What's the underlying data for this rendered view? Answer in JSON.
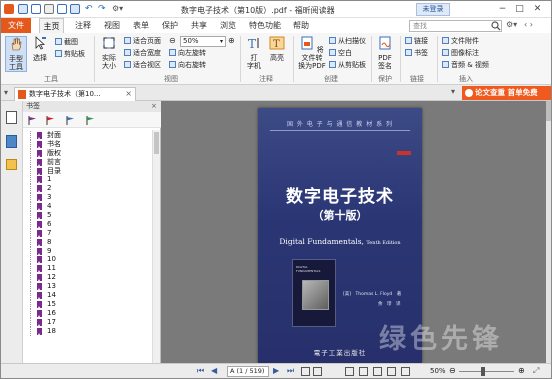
{
  "window": {
    "title": "数字电子技术（第10版）.pdf - 福昕阅读器",
    "login_button": "未登录",
    "minimize": "−",
    "maximize": "□",
    "close": "✕"
  },
  "menu": {
    "file": "文件",
    "tabs": [
      "主页",
      "注释",
      "视图",
      "表单",
      "保护",
      "共享",
      "浏览",
      "特色功能",
      "帮助"
    ],
    "active_tab": "主页",
    "search_placeholder": "查找"
  },
  "ribbon": {
    "hand_tool": "手型\n工具",
    "select": "选择",
    "snapshot": "截图",
    "clipboard": "剪贴板",
    "group_tools": "工具",
    "actual_size": "实际\n大小",
    "fit_page": "适合页面",
    "fit_width": "适合宽度",
    "fit_visible": "适合视区",
    "zoom_value": "50%",
    "rotate_left": "向左旋转",
    "rotate_right": "向右旋转",
    "group_view": "视图",
    "typewriter": "打\n字机",
    "highlight": "高亮",
    "group_comment": "注释",
    "convert_pdf": "将文件转\n换为PDF",
    "from_scanner": "从扫描仪",
    "blank": "空白",
    "from_clipboard": "从剪贴板",
    "group_create": "创建",
    "pdf_sign": "PDF\n签名",
    "group_protect": "保护",
    "link": "链接",
    "bookmark": "书签",
    "group_link": "链接",
    "file_attach": "文件附件",
    "image_annot": "图像标注",
    "audio_video": "音频 & 视频",
    "group_insert": "插入"
  },
  "doc_tab": {
    "label": "数字电子技术（第10...",
    "close": "×"
  },
  "promo": "论文查重  首单免费",
  "sidebar": {
    "header": "书签",
    "bookmarks": [
      "封面",
      "书名",
      "版权",
      "前言",
      "目录",
      "1",
      "2",
      "3",
      "4",
      "5",
      "6",
      "7",
      "8",
      "9",
      "10",
      "11",
      "12",
      "13",
      "14",
      "15",
      "16",
      "17",
      "18"
    ]
  },
  "cover": {
    "series": "国 外 电 子 与 通 信 教 材 系 列",
    "title_cn": "数字电子技术",
    "edition_cn": "（第十版）",
    "title_en": "Digital Fundamentals,",
    "edition_en": "Tenth Edition",
    "inner_title": "DIGITAL\nFUNDAMENTALS",
    "author": "[美]　Thomas L. Floyd　著",
    "translator": "余　璆　译",
    "publisher": "電子工業出版社"
  },
  "watermark": "绿色先锋",
  "status": {
    "page_field": "A (1 / 519)",
    "zoom": "50%"
  },
  "colors": {
    "accent_orange": "#e5581c",
    "cover_blue": "#2a3674",
    "bookmark_icon": "#7a2a8a"
  }
}
